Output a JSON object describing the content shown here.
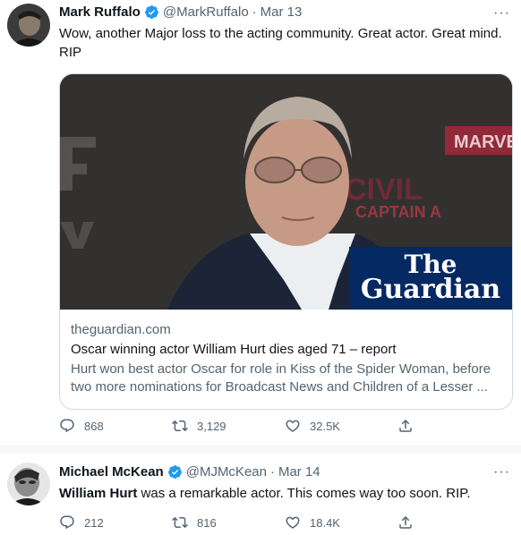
{
  "tweets": [
    {
      "name": "Mark Ruffalo",
      "handle": "@MarkRuffalo",
      "separator": "·",
      "date": "Mar 13",
      "text": "Wow, another Major loss to the acting community. Great actor. Great mind. RIP",
      "card": {
        "domain": "theguardian.com",
        "title": "Oscar winning actor William Hurt dies aged 71 – report",
        "description": "Hurt won best actor Oscar for role in Kiss of the Spider Woman, before two more nominations for Broadcast News and Children of a Lesser ...",
        "logo_line1": "The",
        "logo_line2": "Guardian",
        "logo_color": "#052962"
      },
      "replies": "868",
      "retweets": "3,129",
      "likes": "32.5K"
    },
    {
      "name": "Michael McKean",
      "handle": "@MJMcKean",
      "separator": "·",
      "date": "Mar 14",
      "text_bold": "William Hurt",
      "text_rest": " was a remarkable actor. This comes way too soon. RIP.",
      "replies": "212",
      "retweets": "816",
      "likes": "18.4K"
    }
  ],
  "more_label": "···",
  "icons": [
    "verified-badge-icon",
    "reply-icon",
    "retweet-icon",
    "like-icon",
    "share-icon"
  ],
  "colors": {
    "verified": "#1d9bf0",
    "muted": "#536471",
    "text": "#0f1419"
  }
}
